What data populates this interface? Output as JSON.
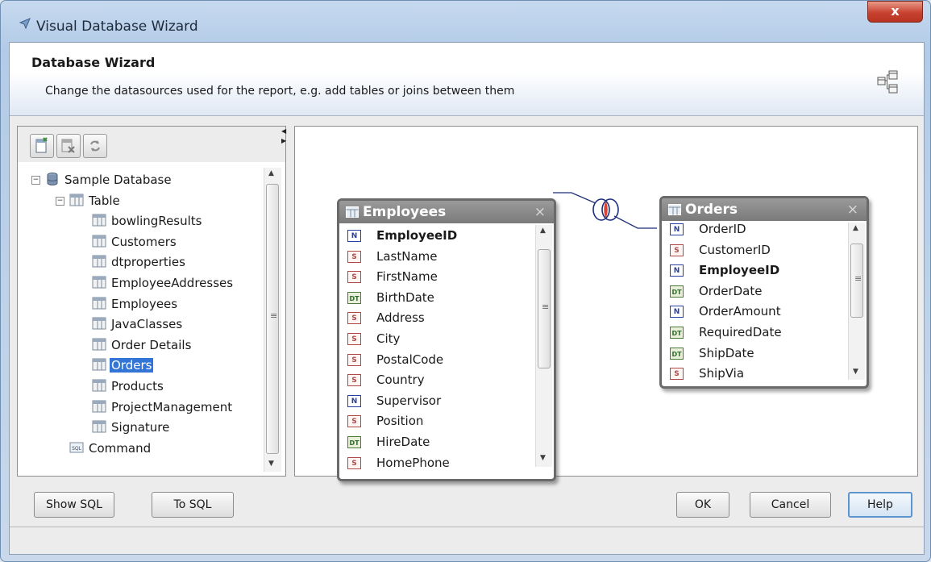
{
  "window": {
    "title": "Visual Database Wizard",
    "close_label": "x"
  },
  "header": {
    "title": "Database Wizard",
    "description": "Change the datasources used for the report, e.g. add tables or joins between them"
  },
  "toolbar": {
    "buttons": [
      "add-table-icon",
      "remove-table-icon",
      "refresh-icon"
    ]
  },
  "tree": {
    "root": "Sample Database",
    "table_node": "Table",
    "tables": [
      "bowlingResults",
      "Customers",
      "dtproperties",
      "EmployeeAddresses",
      "Employees",
      "JavaClasses",
      "Order Details",
      "Orders",
      "Products",
      "ProjectManagement",
      "Signature"
    ],
    "selected": "Orders",
    "command_node": "Command",
    "collapse_glyph": "−"
  },
  "scroll_glyphs": {
    "up": "▲",
    "down": "▼",
    "grip": "≡",
    "split_left": "◀",
    "split_right": "▶"
  },
  "employees_table": {
    "title": "Employees",
    "close": "×",
    "fields": [
      {
        "type": "N",
        "name": "EmployeeID",
        "key": true
      },
      {
        "type": "S",
        "name": "LastName"
      },
      {
        "type": "S",
        "name": "FirstName"
      },
      {
        "type": "DT",
        "name": "BirthDate"
      },
      {
        "type": "S",
        "name": "Address"
      },
      {
        "type": "S",
        "name": "City"
      },
      {
        "type": "S",
        "name": "PostalCode"
      },
      {
        "type": "S",
        "name": "Country"
      },
      {
        "type": "N",
        "name": "Supervisor"
      },
      {
        "type": "S",
        "name": "Position"
      },
      {
        "type": "DT",
        "name": "HireDate"
      },
      {
        "type": "S",
        "name": "HomePhone"
      }
    ]
  },
  "orders_table": {
    "title": "Orders",
    "close": "×",
    "fields": [
      {
        "type": "N",
        "name": "OrderID"
      },
      {
        "type": "S",
        "name": "CustomerID"
      },
      {
        "type": "N",
        "name": "EmployeeID",
        "key": true
      },
      {
        "type": "DT",
        "name": "OrderDate"
      },
      {
        "type": "N",
        "name": "OrderAmount"
      },
      {
        "type": "DT",
        "name": "RequiredDate"
      },
      {
        "type": "DT",
        "name": "ShipDate"
      },
      {
        "type": "S",
        "name": "ShipVia"
      }
    ]
  },
  "buttons": {
    "show_sql": "Show SQL",
    "to_sql": "To SQL",
    "ok": "OK",
    "cancel": "Cancel",
    "help": "Help"
  },
  "colors": {
    "accent": "#3375d7",
    "title_bar": "#b3cbe7",
    "table_header": "#7a7a7a",
    "close_button": "#c84231"
  }
}
